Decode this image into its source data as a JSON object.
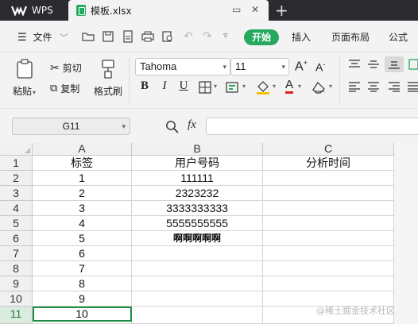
{
  "titlebar": {
    "app_tab": "WPS",
    "file_tab": "模板.xlsx"
  },
  "menubar": {
    "file_menu": "文件",
    "start_button": "开始",
    "tabs": [
      "插入",
      "页面布局",
      "公式"
    ]
  },
  "ribbon": {
    "paste": "粘贴",
    "cut": "剪切",
    "copy": "复制",
    "format_painter": "格式刷",
    "font_name": "Tahoma",
    "font_size": "11",
    "bold": "B",
    "italic": "I",
    "underline": "U"
  },
  "formulabar": {
    "name_box": "G11",
    "fx": "fx",
    "value": ""
  },
  "sheet": {
    "columns": [
      "A",
      "B",
      "C"
    ],
    "rows": [
      {
        "num": "1",
        "a": "标签",
        "b": "用户号码",
        "c": "分析时间"
      },
      {
        "num": "2",
        "a": "1",
        "b": "111111",
        "c": ""
      },
      {
        "num": "3",
        "a": "2",
        "b": "2323232",
        "c": ""
      },
      {
        "num": "4",
        "a": "3",
        "b": "3333333333",
        "c": ""
      },
      {
        "num": "5",
        "a": "4",
        "b": "5555555555",
        "c": ""
      },
      {
        "num": "6",
        "a": "5",
        "b": "啊啊啊啊啊",
        "c": ""
      },
      {
        "num": "7",
        "a": "6",
        "b": "",
        "c": ""
      },
      {
        "num": "8",
        "a": "7",
        "b": "",
        "c": ""
      },
      {
        "num": "9",
        "a": "8",
        "b": "",
        "c": ""
      },
      {
        "num": "10",
        "a": "9",
        "b": "",
        "c": ""
      },
      {
        "num": "11",
        "a": "10",
        "b": "",
        "c": ""
      }
    ]
  },
  "watermark": "@稀土掘金技术社区",
  "colors": {
    "accent_green": "#27a85f",
    "titlebar": "#2a2a2f",
    "selection": "#1e8c46"
  }
}
